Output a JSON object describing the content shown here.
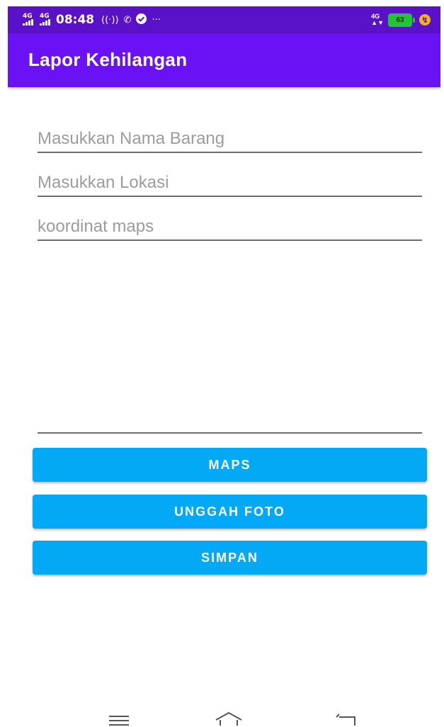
{
  "statusbar": {
    "network_1": "4G",
    "network_2": "4G",
    "time": "08:48",
    "data_network": "4G",
    "battery_level": "63",
    "icons": [
      "signal-icon",
      "signal-icon",
      "hotspot-icon",
      "whatsapp-icon",
      "check-circle-icon",
      "more-dots-icon",
      "battery-icon",
      "charging-icon"
    ]
  },
  "appbar": {
    "title": "Lapor Kehilangan"
  },
  "form": {
    "item_name": {
      "placeholder": "Masukkan Nama Barang",
      "value": ""
    },
    "location": {
      "placeholder": "Masukkan Lokasi",
      "value": ""
    },
    "coordinates": {
      "placeholder": "koordinat maps",
      "value": ""
    },
    "description": {
      "placeholder": "",
      "value": ""
    }
  },
  "buttons": {
    "maps": "MAPS",
    "upload_photo": "UNGGAH FOTO",
    "save": "SIMPAN"
  },
  "colors": {
    "statusbar": "#5a12c9",
    "appbar": "#6b12f5",
    "button": "#03a9f4",
    "placeholder": "#9c9c9c",
    "underline": "#6d6d6d"
  },
  "navbar": {
    "icons": [
      "menu-icon",
      "home-icon",
      "back-icon"
    ]
  }
}
